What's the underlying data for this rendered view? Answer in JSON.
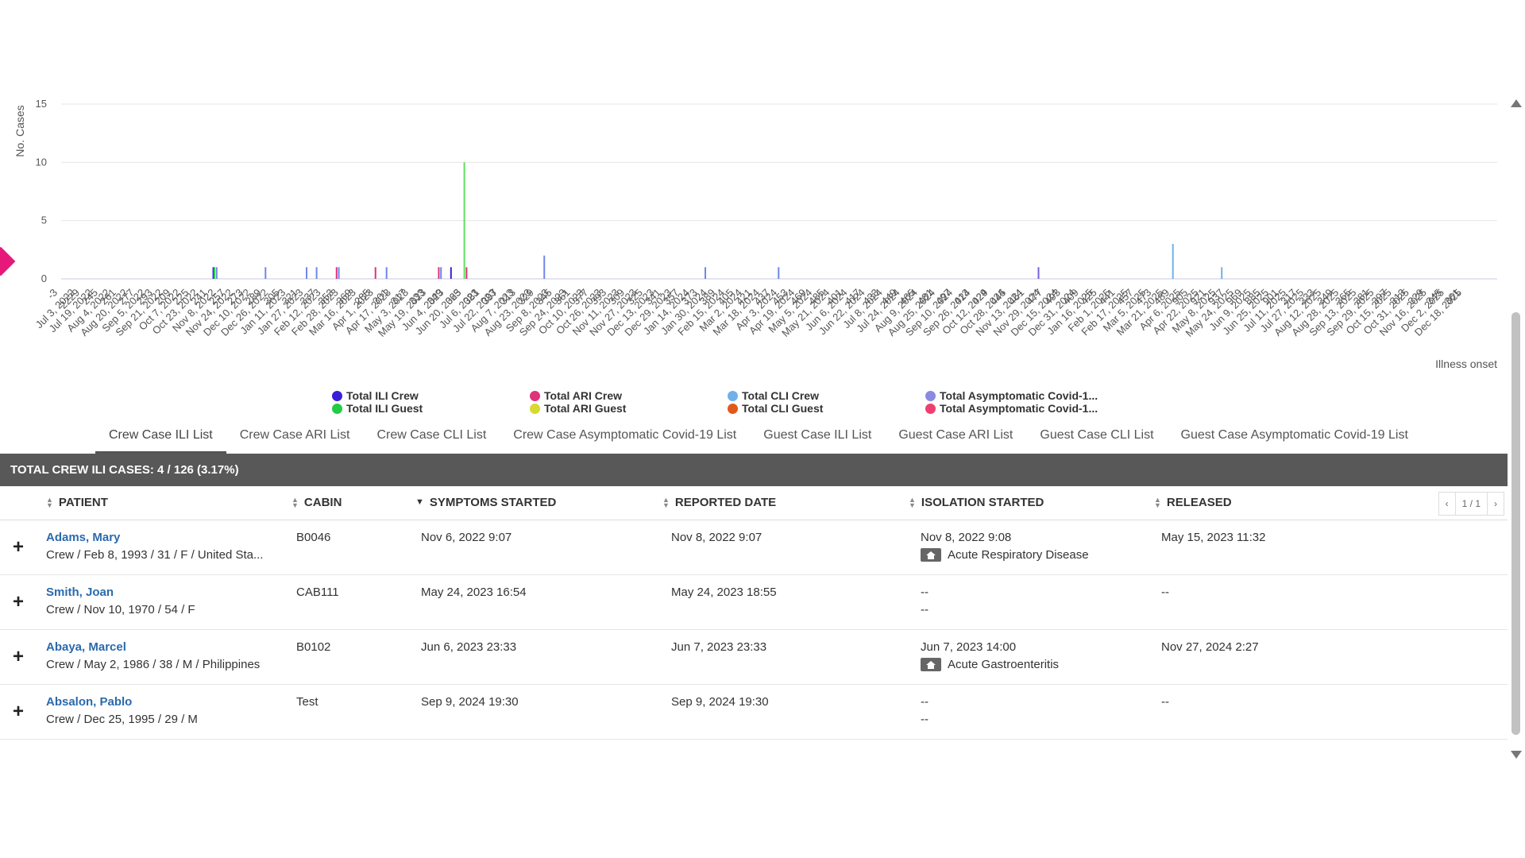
{
  "chart_data": {
    "type": "bar",
    "ylabel": "No. Cases",
    "xlabel": "Illness onset",
    "ylim": [
      0,
      15
    ],
    "yticks": [
      0,
      5,
      10,
      15
    ],
    "categories": [
      "-3",
      "Jul 3, 2022",
      "Jul 19, 2022",
      "Aug 4, 2022",
      "Aug 20, 2022",
      "Sep 5, 2022",
      "Sep 21, 2022",
      "Oct 7, 2022",
      "Oct 23, 2022",
      "Nov 8, 2022",
      "Nov 24, 2022",
      "Dec 10, 2022",
      "Dec 26, 2022",
      "Jan 11, 2023",
      "Jan 27, 2023",
      "Feb 12, 2023",
      "Feb 28, 2023",
      "Mar 16, 2023",
      "Apr 1, 2023",
      "Apr 17, 2023",
      "May 3, 2023",
      "May 19, 2023",
      "Jun 4, 2023",
      "Jun 20, 2023",
      "Jul 6, 2023",
      "Jul 22, 2023",
      "Aug 7, 2023",
      "Aug 23, 2023",
      "Sep 8, 2023",
      "Sep 24, 2023",
      "Oct 10, 2023",
      "Oct 26, 2023",
      "Nov 11, 2023",
      "Nov 27, 2023",
      "Dec 13, 2023",
      "Dec 29, 2023",
      "Jan 14, 2024",
      "Jan 30, 2024",
      "Feb 15, 2024",
      "Mar 2, 2024",
      "Mar 18, 2024",
      "Apr 3, 2024",
      "Apr 19, 2024",
      "May 5, 2024",
      "May 21, 2024",
      "Jun 6, 2024",
      "Jun 22, 2024",
      "Jul 8, 2024",
      "Jul 24, 2024",
      "Aug 9, 2024",
      "Aug 25, 2024",
      "Sep 10, 2024",
      "Sep 26, 2024",
      "Oct 12, 2024",
      "Oct 28, 2024",
      "Nov 13, 2024",
      "Nov 29, 2024",
      "Dec 15, 2024",
      "Dec 31, 2024",
      "Jan 16, 2025",
      "Feb 1, 2025",
      "Feb 17, 2025",
      "Mar 5, 2025",
      "Mar 21, 2025",
      "Apr 6, 2025",
      "Apr 22, 2025",
      "May 8, 2025",
      "May 24, 2025",
      "Jun 9, 2025",
      "Jun 25, 2025",
      "Jul 11, 2025",
      "Jul 27, 2025",
      "Aug 12, 2025",
      "Aug 28, 2025",
      "Sep 13, 2025",
      "Sep 29, 2025",
      "Oct 15, 2025",
      "Oct 31, 2025",
      "Nov 16, 2025",
      "Dec 2, 2025",
      "Dec 18, 2025"
    ],
    "overlay_labels": [
      "2229",
      "245",
      "261",
      "277",
      "293",
      "209",
      "225",
      "241",
      "257",
      "273",
      "289",
      "305",
      "321",
      "337",
      "353",
      "369",
      "285",
      "301",
      "317",
      "333",
      "349",
      "365",
      "381",
      "397",
      "313",
      "329",
      "345",
      "361",
      "377",
      "393",
      "309",
      "325",
      "341",
      "357",
      "373",
      "389",
      "405",
      "421",
      "437",
      "453",
      "469",
      "485",
      "401",
      "417",
      "433",
      "449",
      "465",
      "481",
      "497",
      "413",
      "429",
      "445",
      "461",
      "477",
      "493",
      "409",
      "425",
      "441",
      "457",
      "473",
      "489",
      "905",
      "921",
      "937",
      "969",
      "885",
      "901",
      "317",
      "333",
      "349",
      "365",
      "381",
      "397",
      "313",
      "329",
      "345",
      "361"
    ],
    "bars": [
      {
        "date": "Nov 1, 2022",
        "value": 1,
        "color": "#3a1fd9"
      },
      {
        "date": "Nov 2, 2022",
        "value": 1,
        "color": "#22cc44"
      },
      {
        "date": "Nov 4, 2022",
        "value": 1,
        "color": "#6f86e8"
      },
      {
        "date": "Dec 18, 2022",
        "value": 1,
        "color": "#6f86e8"
      },
      {
        "date": "Jan 24, 2023",
        "value": 1,
        "color": "#6f86e8"
      },
      {
        "date": "Feb 2, 2023",
        "value": 1,
        "color": "#6f86e8"
      },
      {
        "date": "Feb 20, 2023",
        "value": 1,
        "color": "#e0317a"
      },
      {
        "date": "Feb 22, 2023",
        "value": 1,
        "color": "#6f86e8"
      },
      {
        "date": "Mar 27, 2023",
        "value": 1,
        "color": "#e0317a"
      },
      {
        "date": "Apr 6, 2023",
        "value": 1,
        "color": "#6f86e8"
      },
      {
        "date": "May 23, 2023",
        "value": 1,
        "color": "#e0317a"
      },
      {
        "date": "May 25, 2023",
        "value": 1,
        "color": "#6f86e8"
      },
      {
        "date": "Jun 3, 2023",
        "value": 1,
        "color": "#3a1fd9"
      },
      {
        "date": "Jun 15, 2023",
        "value": 10,
        "color": "#5ee05e"
      },
      {
        "date": "Jun 17, 2023",
        "value": 1,
        "color": "#e0317a"
      },
      {
        "date": "Aug 26, 2023",
        "value": 2,
        "color": "#6f86e8"
      },
      {
        "date": "Jan 18, 2024",
        "value": 1,
        "color": "#6f86e8"
      },
      {
        "date": "Mar 24, 2024",
        "value": 1,
        "color": "#6f86e8"
      },
      {
        "date": "Nov 13, 2024",
        "value": 1,
        "color": "#7a5ce0"
      },
      {
        "date": "Mar 14, 2025",
        "value": 3,
        "color": "#70b0e8"
      },
      {
        "date": "Apr 27, 2025",
        "value": 1,
        "color": "#70b0e8"
      }
    ],
    "series": [
      {
        "name": "Total ILI Crew",
        "color": "#3a1fd9"
      },
      {
        "name": "Total ILI Guest",
        "color": "#22cc44"
      },
      {
        "name": "Total ARI Crew",
        "color": "#e0317a"
      },
      {
        "name": "Total ARI Guest",
        "color": "#d8d830"
      },
      {
        "name": "Total CLI Crew",
        "color": "#70b0e8"
      },
      {
        "name": "Total CLI Guest",
        "color": "#e05a1c"
      },
      {
        "name": "Total Asymptomatic Covid-1...",
        "color": "#8a8ae0"
      },
      {
        "name": "Total Asymptomatic Covid-1...",
        "color": "#ee4070"
      }
    ],
    "grid": true,
    "legend": "bottom"
  },
  "tabs": [
    {
      "label": "Crew Case ILI List",
      "active": true
    },
    {
      "label": "Crew Case ARI List"
    },
    {
      "label": "Crew Case CLI List"
    },
    {
      "label": "Crew Case Asymptomatic Covid-19 List"
    },
    {
      "label": "Guest Case ILI List"
    },
    {
      "label": "Guest Case ARI List"
    },
    {
      "label": "Guest Case CLI List"
    },
    {
      "label": "Guest Case Asymptomatic Covid-19 List"
    }
  ],
  "table": {
    "title": "TOTAL CREW ILI CASES: 4 / 126 (3.17%)",
    "columns": [
      "PATIENT",
      "CABIN",
      "SYMPTOMS STARTED",
      "REPORTED DATE",
      "ISOLATION STARTED",
      "RELEASED"
    ],
    "sorted_column": "SYMPTOMS STARTED",
    "pager": {
      "prev": "‹",
      "page": "1 / 1",
      "next": "›"
    },
    "rows": [
      {
        "name": "Adams, Mary",
        "details": "Crew / Feb 8, 1993 / 31 / F / United Sta...",
        "cabin": "B0046",
        "symptoms": "Nov 6, 2022 9:07",
        "reported": "Nov 8, 2022 9:07",
        "isolation": "Nov 8, 2022 9:08",
        "diagnosis": "Acute Respiratory Disease",
        "released": "May 15, 2023 11:32"
      },
      {
        "name": "Smith, Joan",
        "details": "Crew / Nov 10, 1970 / 54 / F",
        "cabin": "CAB111",
        "symptoms": "May 24, 2023 16:54",
        "reported": "May 24, 2023 18:55",
        "isolation": "--",
        "diagnosis": "--",
        "released": "--"
      },
      {
        "name": "Abaya, Marcel",
        "details": "Crew / May 2, 1986 / 38 / M / Philippines",
        "cabin": "B0102",
        "symptoms": "Jun 6, 2023 23:33",
        "reported": "Jun 7, 2023 23:33",
        "isolation": "Jun 7, 2023 14:00",
        "diagnosis": "Acute Gastroenteritis",
        "released": "Nov 27, 2024 2:27"
      },
      {
        "name": "Absalon, Pablo",
        "details": "Crew / Dec 25, 1995 / 29 / M",
        "cabin": "Test",
        "symptoms": "Sep 9, 2024 19:30",
        "reported": "Sep 9, 2024 19:30",
        "isolation": "--",
        "diagnosis": "--",
        "released": "--"
      }
    ]
  }
}
